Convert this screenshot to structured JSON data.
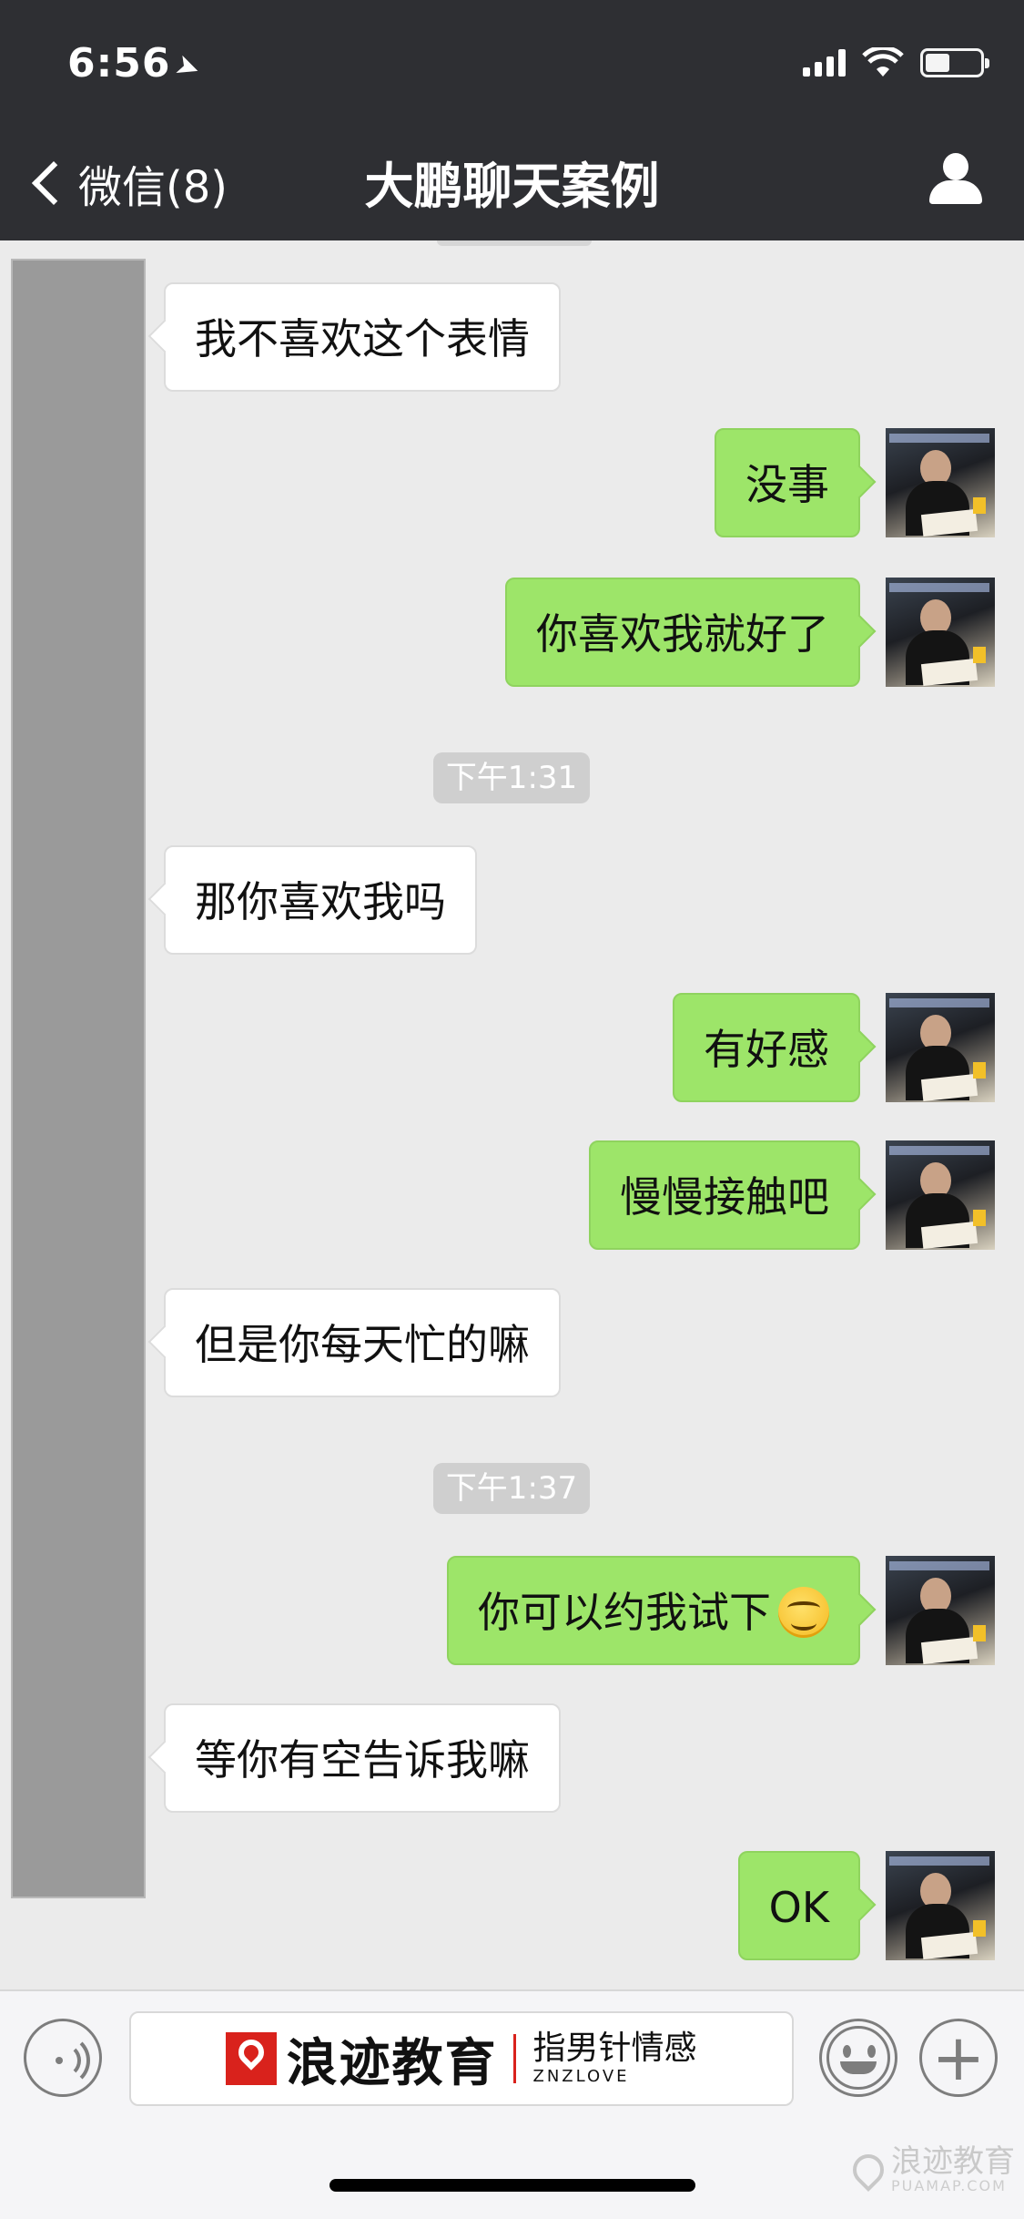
{
  "status": {
    "time": "6:56",
    "location_icon": "location-arrow-icon"
  },
  "nav": {
    "back_label": "微信(8)",
    "title": "大鹏聊天案例",
    "profile_icon": "person-icon"
  },
  "colors": {
    "header_bg": "#2e2f33",
    "chat_bg": "#ebebeb",
    "outgoing_bubble": "#9de569",
    "incoming_bubble": "#ffffff",
    "timestamp_pill": "#cfcfcf",
    "brand_red": "#d9221c"
  },
  "messages": [
    {
      "side": "in",
      "text": "我不喜欢这个表情"
    },
    {
      "side": "out",
      "text": "没事"
    },
    {
      "side": "out",
      "text": "你喜欢我就好了"
    },
    {
      "type": "time",
      "text": "下午1:31"
    },
    {
      "side": "in",
      "text": "那你喜欢我吗"
    },
    {
      "side": "out",
      "text": "有好感"
    },
    {
      "side": "out",
      "text": "慢慢接触吧"
    },
    {
      "side": "in",
      "text": "但是你每天忙的嘛"
    },
    {
      "type": "time",
      "text": "下午1:37"
    },
    {
      "side": "out",
      "text": "你可以约我试下",
      "emoji": "grinning-face-emoji"
    },
    {
      "side": "in",
      "text": "等你有空告诉我嘛"
    },
    {
      "side": "out",
      "text": "OK"
    }
  ],
  "input_bar": {
    "voice_icon": "voice-icon",
    "emoji_icon": "emoji-icon",
    "plus_icon": "plus-icon",
    "plus_glyph": "+",
    "ad": {
      "brand": "浪迹教育",
      "slogan": "指男针情感",
      "sub": "ZNZLOVE"
    }
  },
  "watermark": {
    "cn": "浪迹教育",
    "en": "PUAMAP.COM"
  }
}
